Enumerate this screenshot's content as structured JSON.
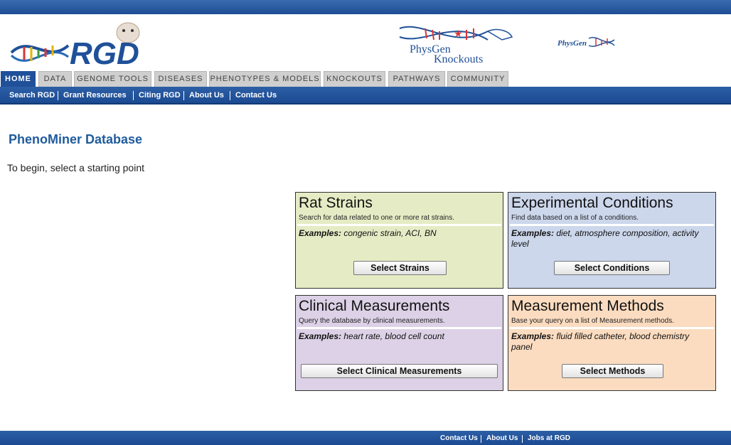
{
  "header": {
    "logo_text": "RGD",
    "physgen_knockouts_line1": "PhysGen",
    "physgen_knockouts_line2": "Knockouts",
    "physgen_text": "PhysGen"
  },
  "nav": {
    "tabs": [
      "HOME",
      "DATA",
      "GENOME TOOLS",
      "DISEASES",
      "PHENOTYPES & MODELS",
      "KNOCKOUTS",
      "PATHWAYS",
      "COMMUNITY"
    ],
    "active": "HOME"
  },
  "subnav": {
    "items": [
      "Search RGD",
      "Grant Resources",
      "Citing RGD",
      "About Us",
      "Contact Us"
    ]
  },
  "main": {
    "title": "PhenoMiner Database",
    "intro": "To begin, select a starting point"
  },
  "boxes": {
    "strains": {
      "title": "Rat Strains",
      "desc": "Search for data related to one or more rat strains.",
      "examples_label": "Examples:",
      "examples": " congenic strain, ACI, BN",
      "button": "Select Strains"
    },
    "conditions": {
      "title": "Experimental Conditions",
      "desc": "Find data based on a list of a conditions.",
      "examples_label": "Examples:",
      "examples": " diet, atmosphere composition, activity level",
      "button": "Select Conditions"
    },
    "clinical": {
      "title": "Clinical Measurements",
      "desc": "Query the database by clinical measurements.",
      "examples_label": "Examples:",
      "examples": " heart rate, blood cell count",
      "button": "Select Clinical Measurements"
    },
    "methods": {
      "title": "Measurement Methods",
      "desc": "Base your query on a list of Measurement methods.",
      "examples_label": "Examples:",
      "examples": " fluid filled catheter, blood chemistry panel",
      "button": "Select Methods"
    }
  },
  "footer": {
    "items": [
      "Contact Us",
      "About Us",
      "Jobs at RGD"
    ]
  },
  "colors": {
    "brand_blue": "#1f5099",
    "strains_bg": "#e5ecc5",
    "conditions_bg": "#ccd7ec",
    "clinical_bg": "#dcd1e6",
    "methods_bg": "#fbdcc0"
  }
}
